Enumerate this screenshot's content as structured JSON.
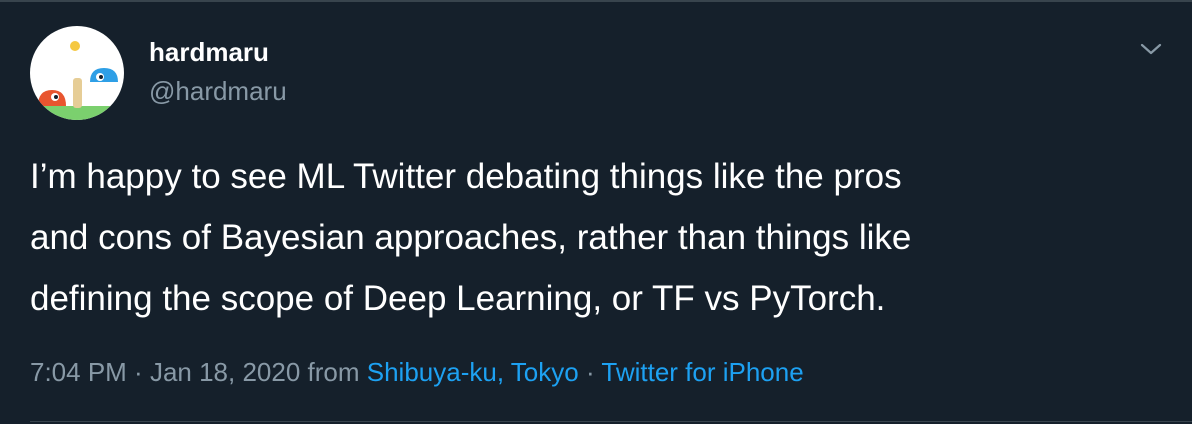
{
  "author": {
    "display_name": "hardmaru",
    "handle": "@hardmaru"
  },
  "menu": {
    "icon": "chevron-down-icon"
  },
  "tweet": {
    "lines": [
      "I’m happy to see ML Twitter debating things like the pros",
      "and cons of Bayesian approaches, rather than things like",
      "defining the scope of Deep Learning, or TF vs PyTorch."
    ]
  },
  "meta": {
    "time": "7:04 PM",
    "sep1": " · ",
    "date": "Jan 18, 2020",
    "from_label": " from ",
    "location": "Shibuya-ku, Tokyo",
    "sep2": " · ",
    "source": "Twitter for iPhone"
  },
  "colors": {
    "background": "#15202b",
    "primary_text": "#ffffff",
    "secondary_text": "#8899a6",
    "link": "#1da1f2",
    "border": "#38444d"
  }
}
